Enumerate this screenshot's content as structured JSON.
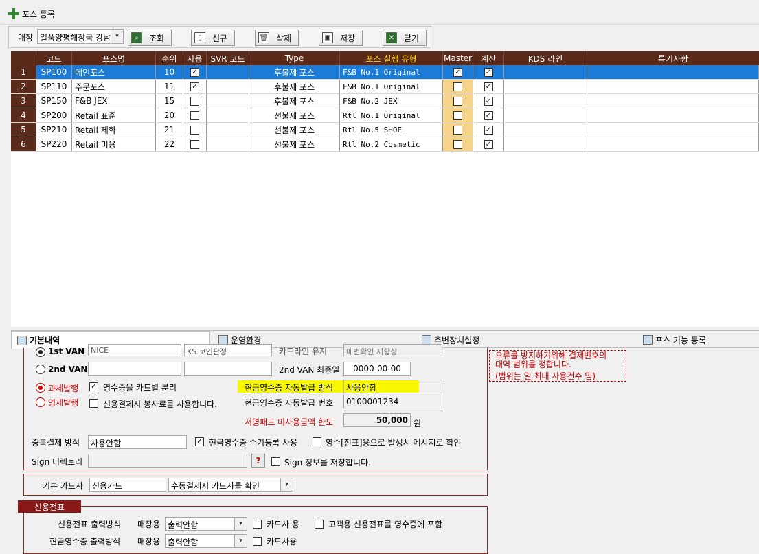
{
  "window": {
    "title": "포스 등록"
  },
  "toolbar": {
    "store_label": "매장",
    "store_value": "일품양평해장국 강남",
    "buttons": [
      {
        "label": "조회",
        "icon": "search-icon"
      },
      {
        "label": "신규",
        "icon": "new-doc-icon"
      },
      {
        "label": "삭제",
        "icon": "trash-icon"
      },
      {
        "label": "저장",
        "icon": "save-icon"
      },
      {
        "label": "닫기",
        "icon": "close-icon"
      }
    ]
  },
  "grid": {
    "columns": [
      "코드",
      "포스명",
      "순위",
      "사용",
      "SVR 코드",
      "Type",
      "포스 실행 유형",
      "Master",
      "계산",
      "KDS 라인",
      "특기사항"
    ],
    "rows": [
      {
        "num": "1",
        "code": "SP100",
        "name": "메인포스",
        "rank": "10",
        "use": true,
        "svr": "",
        "type": "후불제 포스",
        "exec": "F&B No.1 Original",
        "master": true,
        "calc": true,
        "selected": true
      },
      {
        "num": "2",
        "code": "SP110",
        "name": "주문포스",
        "rank": "11",
        "use": true,
        "svr": "",
        "type": "후불제 포스",
        "exec": "F&B No.1 Original",
        "master": false,
        "calc": true,
        "selected": false
      },
      {
        "num": "3",
        "code": "SP150",
        "name": "F&B JEX",
        "rank": "15",
        "use": false,
        "svr": "",
        "type": "후불제 포스",
        "exec": "F&B No.2 JEX",
        "master": false,
        "calc": true,
        "selected": false
      },
      {
        "num": "4",
        "code": "SP200",
        "name": "Retail 표준",
        "rank": "20",
        "use": false,
        "svr": "",
        "type": "선불제 포스",
        "exec": "Rtl No.1 Original",
        "master": false,
        "calc": true,
        "selected": false
      },
      {
        "num": "5",
        "code": "SP210",
        "name": "Retail 제화",
        "rank": "21",
        "use": false,
        "svr": "",
        "type": "선불제 포스",
        "exec": "Rtl No.5 SHOE",
        "master": false,
        "calc": true,
        "selected": false
      },
      {
        "num": "6",
        "code": "SP220",
        "name": "Retail 미용",
        "rank": "22",
        "use": false,
        "svr": "",
        "type": "선불제 포스",
        "exec": "Rtl No.2 Cosmetic",
        "master": false,
        "calc": true,
        "selected": false
      }
    ]
  },
  "tabs": [
    {
      "label": "기본내역",
      "active": true
    },
    {
      "label": "운영환경",
      "active": false
    },
    {
      "label": "주변장치설정",
      "active": false
    },
    {
      "label": "포스 기능 등록",
      "active": false
    }
  ],
  "basic": {
    "first_van_label": "1st VAN",
    "first_van_value": "NICE",
    "first_van_extra": "KS.코인판정",
    "first_van_field_label": "카드라인 유지",
    "first_van_field_value": "매번확인 재항상",
    "second_van_label": "2nd VAN",
    "second_van_last_label": "2nd VAN 최종일",
    "second_van_last_value": "0000-00-00",
    "tax_label": "과세발행",
    "zero_tax_label": "영세발행",
    "split_receipt_label": "영수증을 카드별 분리",
    "service_fee_label": "신용결제시 봉사료를 사용합니다.",
    "cash_auto_label": "현금영수증 자동발급 방식",
    "cash_auto_value": "사용안함",
    "cash_auto_no_label": "현금영수증 자동발급 번호",
    "cash_auto_no_value": "0100001234",
    "sign_limit_label": "서명패드 미사용금액 한도",
    "sign_limit_value": "50,000",
    "sign_limit_unit": "원",
    "dup_pay_label": "중복결제 방식",
    "dup_pay_value": "사용안함",
    "cash_manual_label": "현금영수증 수기등록 사용",
    "receipt_msg_label": "영수[전표]용으로 발생시 메시지로 확인",
    "sign_dir_label": "Sign 디렉토리",
    "sign_dir_value": "",
    "sign_dir_btn": "?",
    "sign_save_label": "Sign 정보를 저장합니다.",
    "note_line1": "오류를 방지하기위해 결제번호의",
    "note_line2": "대역 범위를 정합니다.",
    "note_line3": "(범위는 일 최대 사용건수 임)"
  },
  "card": {
    "default_label": "기본 카드사",
    "default_value": "신용카드",
    "manual_value": "수동결제시 카드사를 확인"
  },
  "credit_slip": {
    "header": "신용전표",
    "slip_output_label": "신용전표 출력방식",
    "store_use_label": "매장용",
    "slip_output_value": "출력안함",
    "card_co_label": "카드사 용",
    "include_label": "고객용 신용전표를 영수증에 포함",
    "cash_output_label": "현금영수증 출력방식",
    "cash_store_use_label": "매장용",
    "cash_output_value": "출력안함",
    "card_use_label": "카드사용"
  },
  "colors": {
    "header_bg": "#5a2a1a",
    "selected_row": "#1c7bd6",
    "master_bg": "#f5d48a",
    "accent_red": "#c00000",
    "highlight": "#f8f800"
  }
}
